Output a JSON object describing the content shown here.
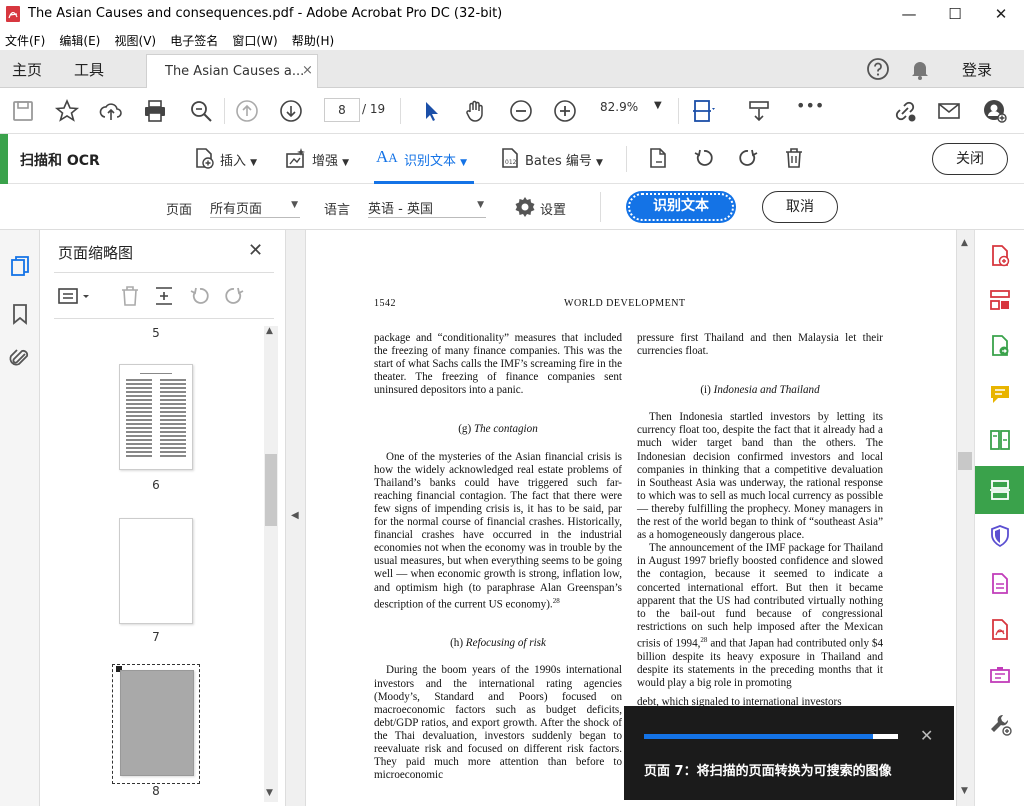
{
  "window": {
    "title": "The Asian Causes and consequences.pdf - Adobe Acrobat Pro DC (32-bit)",
    "minimize": "—",
    "maximize": "☐",
    "close": "✕"
  },
  "menu": [
    "文件(F)",
    "编辑(E)",
    "视图(V)",
    "电子签名",
    "窗口(W)",
    "帮助(H)"
  ],
  "tabs": {
    "home": "主页",
    "tools": "工具",
    "document": "The Asian Causes a...",
    "document_close": "×",
    "login": "登录",
    "help_icon": "question-icon",
    "bell_icon": "bell-icon"
  },
  "toolbar": {
    "page_current": "8",
    "page_total": "/ 19",
    "zoom": "82.9%",
    "more": "•••"
  },
  "ocr": {
    "title": "扫描和 OCR",
    "insert": "插入",
    "enhance": "增强",
    "recognize": "识别文本",
    "bates": "Bates 编号",
    "close": "关闭",
    "recognize_icon_text": "AA"
  },
  "options": {
    "page_label": "页面",
    "page_value": "所有页面",
    "lang_label": "语言",
    "lang_value": "英语 - 英国",
    "settings": "设置",
    "recognize_button": "识别文本",
    "cancel_button": "取消"
  },
  "thumbnails": {
    "title": "页面缩略图",
    "close": "✕",
    "pages": [
      "5",
      "6",
      "7",
      "8"
    ]
  },
  "document": {
    "page_number": "1542",
    "running_head": "WORLD DEVELOPMENT",
    "left": {
      "p1": "package and “conditionality” measures that included the freezing of many finance companies. This was the start of what Sachs calls the IMF’s screaming fire in the theater. The freezing of finance companies sent uninsured depositors into a panic.",
      "h1_label": "(g)",
      "h1": "The contagion",
      "p2": "One of the mysteries of the Asian financial crisis is how the widely acknowledged real estate problems of Thailand’s banks could have triggered such far-reaching financial contagion. The fact that there were few signs of impending crisis is, it has to be said, par for the normal course of financial crashes. Historically, financial crashes have occurred in the industrial economies not when the economy was in trouble by the usual measures, but when everything seems to be going well — when economic growth is strong, inflation low, and optimism high (to paraphrase Alan Greenspan’s description of the current US economy).",
      "p2_note": "28",
      "h2_label": "(h)",
      "h2": "Refocusing of risk",
      "p3": "During the boom years of the 1990s international investors and the international rating agencies (Moody’s, Standard and Poors) focused on macroeconomic factors such as budget deficits, debt/GDP ratios, and export growth. After the shock of the Thai devaluation, investors suddenly began to reevaluate risk and focused on different risk factors. They paid much more attention than before to microeconomic"
    },
    "right": {
      "p1": "pressure first Thailand and then Malaysia let their currencies float.",
      "h1_label": "(i)",
      "h1": "Indonesia and Thailand",
      "p2": "Then Indonesia startled investors by letting its currency float too, despite the fact that it already had a much wider target band than the others. The Indonesian decision confirmed investors and local companies in thinking that a competitive devaluation in Southeast Asia was underway, the rational response to which was to sell as much local currency as possible — thereby fulfilling the prophecy. Money managers in the rest of the world began to think of “southeast Asia” as a homogeneously dangerous place.",
      "p3": "The announcement of the IMF package for Thailand in August 1997 briefly boosted confidence and slowed the contagion, because it seemed to indicate a concerted international effort. But then it became apparent that the US had contributed virtually nothing to the bail-out fund because of congressional restrictions on such help imposed after the Mexican crisis of 1994,",
      "p3_note": "28",
      "p3b": " and that Japan had contributed only $4 billion despite its heavy exposure in Thailand and despite its statements in the preceding months that it would play a big role in promoting",
      "p4": "debt, which signaled to international investors"
    }
  },
  "progress": {
    "fraction": 0.9,
    "text": "页面 7：将扫描的页面转换为可搜索的图像",
    "close": "✕"
  },
  "colors": {
    "accent": "#1473e6",
    "green": "#3aa24b",
    "acrobat_red": "#d7373f"
  }
}
